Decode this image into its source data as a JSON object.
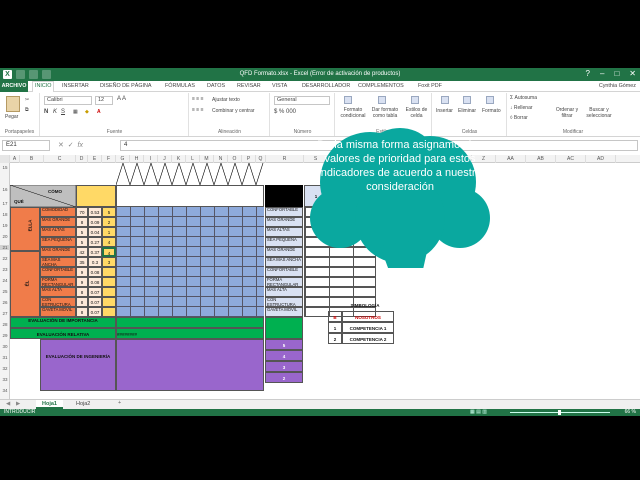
{
  "window": {
    "title": "QFD Formato.xlsx - Excel (Error de activación de productos)",
    "controls": [
      "?",
      "–",
      "□",
      "✕"
    ]
  },
  "menu": {
    "file": "ARCHIVO",
    "tabs": [
      "INICIO",
      "INSERTAR",
      "DISEÑO DE PÁGINA",
      "FÓRMULAS",
      "DATOS",
      "REVISAR",
      "VISTA",
      "DESARROLLADOR",
      "COMPLEMENTOS",
      "Foxit PDF"
    ],
    "user": "Cynthia Gómez"
  },
  "ribbon": {
    "paste": "Pegar",
    "clipboard": "Portapapeles",
    "font_name": "Calibri",
    "font_size": "12",
    "font_group": "Fuente",
    "wrap": "Ajustar texto",
    "merge": "Combinar y centrar",
    "align_group": "Alineación",
    "number_format": "General",
    "number_group": "Número",
    "cond_format": "Formato condicional",
    "table_format": "Dar formato como tabla",
    "cell_styles": "Estilos de celda",
    "styles_group": "Estilos",
    "insert": "Insertar",
    "delete": "Eliminar",
    "format": "Formato",
    "cells_group": "Celdas",
    "autosum": "Autosuma",
    "fill": "Rellenar",
    "clear": "Borrar",
    "sort": "Ordenar y filtrar",
    "find": "Buscar y seleccionar",
    "modify_group": "Modificar"
  },
  "formula": {
    "namebox": "E21",
    "value": "4"
  },
  "columns": [
    "A",
    "B",
    "C",
    "D",
    "E",
    "F",
    "G",
    "H",
    "I",
    "J",
    "K",
    "L",
    "M",
    "N",
    "O",
    "P",
    "Q",
    "R",
    "S",
    "T",
    "U",
    "V",
    "W",
    "X",
    "Y",
    "Z",
    "AA",
    "AB",
    "AC",
    "AD"
  ],
  "rows": [
    "15",
    "16",
    "17",
    "18",
    "19",
    "20",
    "21",
    "22",
    "23",
    "24",
    "25",
    "26",
    "27",
    "28",
    "29",
    "30",
    "31",
    "32",
    "33",
    "34",
    "35",
    "36",
    "37",
    "38",
    "39",
    "40"
  ],
  "sheet": {
    "como": "CÓMO",
    "que": "QUÉ",
    "group1": "ELLA",
    "group2": "ÉL",
    "requirements": [
      {
        "label": "COMODIDAD",
        "c": "70",
        "d": "0.53",
        "e": "5"
      },
      {
        "label": "MÁS GRANDE",
        "c": "8",
        "d": "0.09",
        "e": "2"
      },
      {
        "label": "MÁS ALTAS",
        "c": "5",
        "d": "0.04",
        "e": "1"
      },
      {
        "label": "SEA PEQUEÑA",
        "c": "5",
        "d": "0.27",
        "e": "4"
      },
      {
        "label": "MÁS GRANDE",
        "c": "42",
        "d": "0.37",
        "e": "4"
      },
      {
        "label": "SEA MÁS ANCHA",
        "c": "35",
        "d": "0.3",
        "e": "3"
      },
      {
        "label": "CONFORTABLE",
        "c": "9",
        "d": "0.08",
        "e": ""
      },
      {
        "label": "FORMA RECTANGULAR",
        "c": "9",
        "d": "0.08",
        "e": ""
      },
      {
        "label": "MÁS ALTA",
        "c": "8",
        "d": "0.07",
        "e": ""
      },
      {
        "label": "CON ESTRUCTURA",
        "c": "8",
        "d": "0.07",
        "e": ""
      },
      {
        "label": "GAVETA MÓVIL",
        "c": "8",
        "d": "0.07",
        "e": ""
      }
    ],
    "right_labels": [
      "CONFORTABLE",
      "MÁS GRANDE",
      "MÁS ALTAS",
      "SEA PEQUEÑA",
      "MÁS GRANDE",
      "SEA MÁS ANCHA",
      "CONFORTABLE",
      "FORMA RECTANGULAR",
      "MÁS ALTA",
      "CON ESTRUCTURA",
      "GAVETA MÓVIL"
    ],
    "eval_importance": "EVALUACIÓN DE IMPORTANCIA",
    "eval_relative": "EVALUACIÓN RELATIVA",
    "eval_engineering": "EVALUACIÓN DE INGENIERÍA",
    "eng_scale": [
      "5",
      "4",
      "3",
      "2"
    ],
    "competitor_cols": [
      "1",
      "2",
      "3"
    ],
    "hashes": "########",
    "symbology_title": "SIMBOLOGÍA",
    "symbology": [
      {
        "mark": "B",
        "label": "NOSOTROS"
      },
      {
        "mark": "1",
        "label": "COMPETENCIA 1"
      },
      {
        "mark": "2",
        "label": "COMPETENCIA 2"
      }
    ]
  },
  "callout": {
    "text": "De la misma forma asignamos los valores de prioridad para estos indicadores de acuerdo a nuestra consideración"
  },
  "sheets": {
    "tabs": [
      "Hoja1",
      "Hoja2"
    ],
    "add": "+"
  },
  "status": {
    "mode": "INTRODUCIR",
    "zoom": "66 %"
  },
  "colors": {
    "excel_green": "#217346",
    "orange": "#f4b183",
    "red_orange": "#f07c4a",
    "yellow": "#ffd966",
    "blue": "#8eaadb",
    "green_band": "#00b050",
    "purple": "#9966cc",
    "callout": "#0aa89f"
  }
}
